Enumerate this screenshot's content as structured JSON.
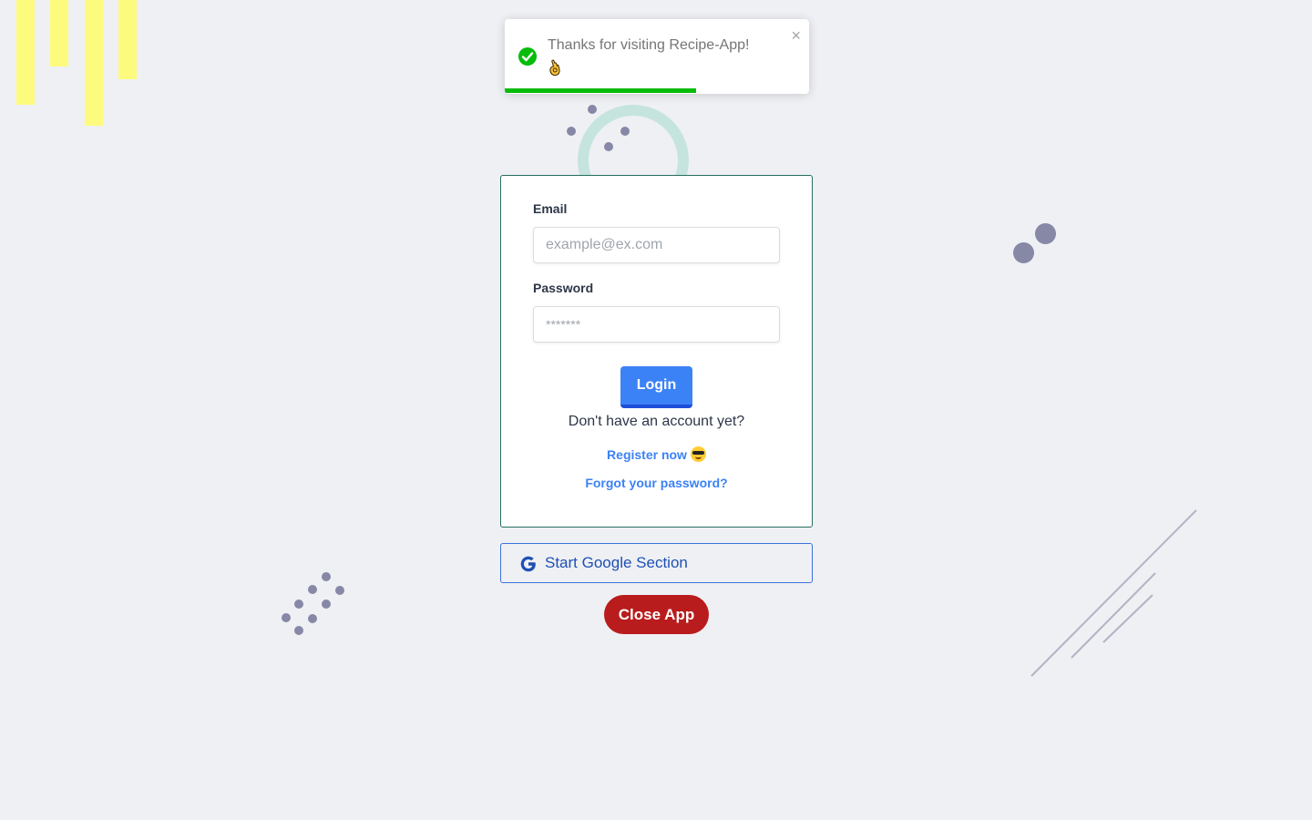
{
  "toast": {
    "message": "Thanks for visiting Recipe-App!",
    "emoji_icon": "ok-hand-icon",
    "close_label": "×",
    "progress": 0.63,
    "success_color": "#07bc0c"
  },
  "login_form": {
    "email_label": "Email",
    "email_placeholder": "example@ex.com",
    "password_label": "Password",
    "password_placeholder": "*******",
    "login_button": "Login",
    "no_account_text": "Don't have an account yet?",
    "register_link": "Register now",
    "register_emoji_icon": "sunglasses-face-icon",
    "forgot_link": "Forgot your password?"
  },
  "google_button": {
    "label": "Start Google Section",
    "icon": "google-icon"
  },
  "close_button": {
    "label": "Close App"
  },
  "colors": {
    "background": "#eff0f4",
    "primary": "#3b82f6",
    "danger": "#b91c1c",
    "card_border": "#256e5e",
    "accent_yellow": "#fdfb7d",
    "decor_dots": "#8787a6"
  }
}
